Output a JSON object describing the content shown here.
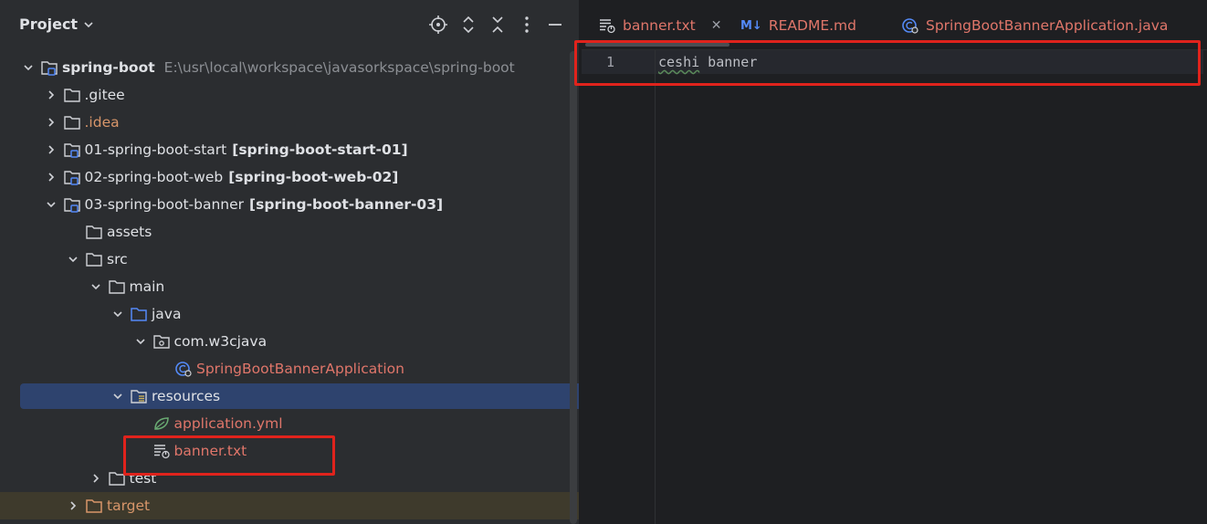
{
  "panel": {
    "title": "Project"
  },
  "tree": [
    {
      "depth": 0,
      "arrow": "down",
      "icon": "module-folder",
      "label": "spring-boot",
      "label_style": "bold",
      "path": "E:\\usr\\local\\workspace\\javasorkspace\\spring-boot"
    },
    {
      "depth": 1,
      "arrow": "right",
      "icon": "folder",
      "label": ".gitee"
    },
    {
      "depth": 1,
      "arrow": "right",
      "icon": "folder",
      "label": ".idea",
      "label_style": "orange"
    },
    {
      "depth": 1,
      "arrow": "right",
      "icon": "module-folder",
      "label": "01-spring-boot-start",
      "module": "[spring-boot-start-01]"
    },
    {
      "depth": 1,
      "arrow": "right",
      "icon": "module-folder",
      "label": "02-spring-boot-web",
      "module": "[spring-boot-web-02]"
    },
    {
      "depth": 1,
      "arrow": "down",
      "icon": "module-folder",
      "label": "03-spring-boot-banner",
      "module": "[spring-boot-banner-03]"
    },
    {
      "depth": 2,
      "arrow": "none",
      "icon": "folder",
      "label": "assets"
    },
    {
      "depth": 2,
      "arrow": "down",
      "icon": "folder",
      "label": "src"
    },
    {
      "depth": 3,
      "arrow": "down",
      "icon": "folder",
      "label": "main"
    },
    {
      "depth": 4,
      "arrow": "down",
      "icon": "source-folder",
      "label": "java"
    },
    {
      "depth": 5,
      "arrow": "down",
      "icon": "package",
      "label": "com.w3cjava"
    },
    {
      "depth": 6,
      "arrow": "none",
      "icon": "spring-class",
      "label": "SpringBootBannerApplication",
      "label_style": "red"
    },
    {
      "depth": 4,
      "arrow": "down",
      "icon": "resources-folder",
      "label": "resources",
      "selected": true
    },
    {
      "depth": 5,
      "arrow": "none",
      "icon": "spring-leaf",
      "label": "application.yml",
      "label_style": "red"
    },
    {
      "depth": 5,
      "arrow": "none",
      "icon": "text-file",
      "label": "banner.txt",
      "label_style": "red"
    },
    {
      "depth": 3,
      "arrow": "right",
      "icon": "folder",
      "label": "test"
    },
    {
      "depth": 2,
      "arrow": "right",
      "icon": "excluded-folder",
      "label": "target",
      "label_style": "orange",
      "excluded": true
    }
  ],
  "editor": {
    "tabs": [
      {
        "label": "banner.txt",
        "icon": "text-file",
        "closable": true,
        "active": true
      },
      {
        "label": "README.md",
        "icon": "markdown",
        "badge": "M↓"
      },
      {
        "label": "SpringBootBannerApplication.java",
        "icon": "spring-class"
      }
    ],
    "lines": [
      {
        "number": "1",
        "text_typo": "ceshi",
        "text_rest": " banner"
      }
    ]
  },
  "colors": {
    "highlight_box": "#e0231c",
    "selection": "#2e436e",
    "modified_file": "#e0766a",
    "excluded": "#d8966a"
  }
}
